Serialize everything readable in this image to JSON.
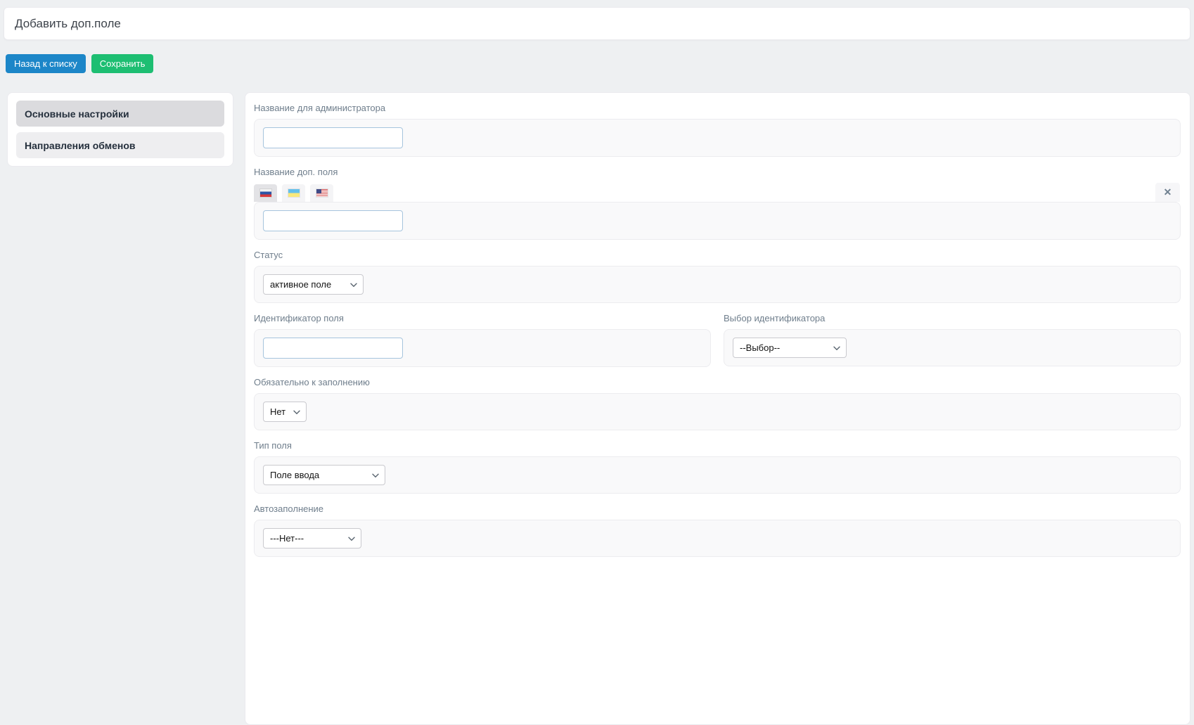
{
  "header": {
    "title": "Добавить доп.поле"
  },
  "toolbar": {
    "back_label": "Назад к списку",
    "save_label": "Сохранить"
  },
  "sidebar": {
    "items": [
      {
        "label": "Основные настройки",
        "active": true
      },
      {
        "label": "Направления обменов",
        "active": false
      }
    ]
  },
  "form": {
    "admin_name": {
      "label": "Название для администратора",
      "value": ""
    },
    "dop_name": {
      "label": "Название доп. поля",
      "value": "",
      "languages": [
        {
          "code": "ru",
          "icon": "flag-ru-icon",
          "active": true
        },
        {
          "code": "ua",
          "icon": "flag-ua-icon",
          "active": false
        },
        {
          "code": "us",
          "icon": "flag-us-icon",
          "active": false
        }
      ],
      "close_icon": "✕"
    },
    "status": {
      "label": "Статус",
      "value": "активное поле"
    },
    "identifier": {
      "label": "Идентификатор поля",
      "value": ""
    },
    "identifier_select": {
      "label": "Выбор идентификатора",
      "value": "--Выбор--"
    },
    "required": {
      "label": "Обязательно к заполнению",
      "value": "Нет"
    },
    "field_type": {
      "label": "Тип поля",
      "value": "Поле ввода"
    },
    "autofill": {
      "label": "Автозаполнение",
      "value": "---Нет---"
    }
  },
  "icons": {
    "chevron": "chevron-down-icon",
    "close": "close-icon"
  },
  "colors": {
    "button_blue": "#1c86c8",
    "button_green": "#1dbe72",
    "input_border_blue": "#a6c4dd",
    "sidebar_active_bg": "#dbdbde",
    "page_background": "#eef0f2"
  }
}
